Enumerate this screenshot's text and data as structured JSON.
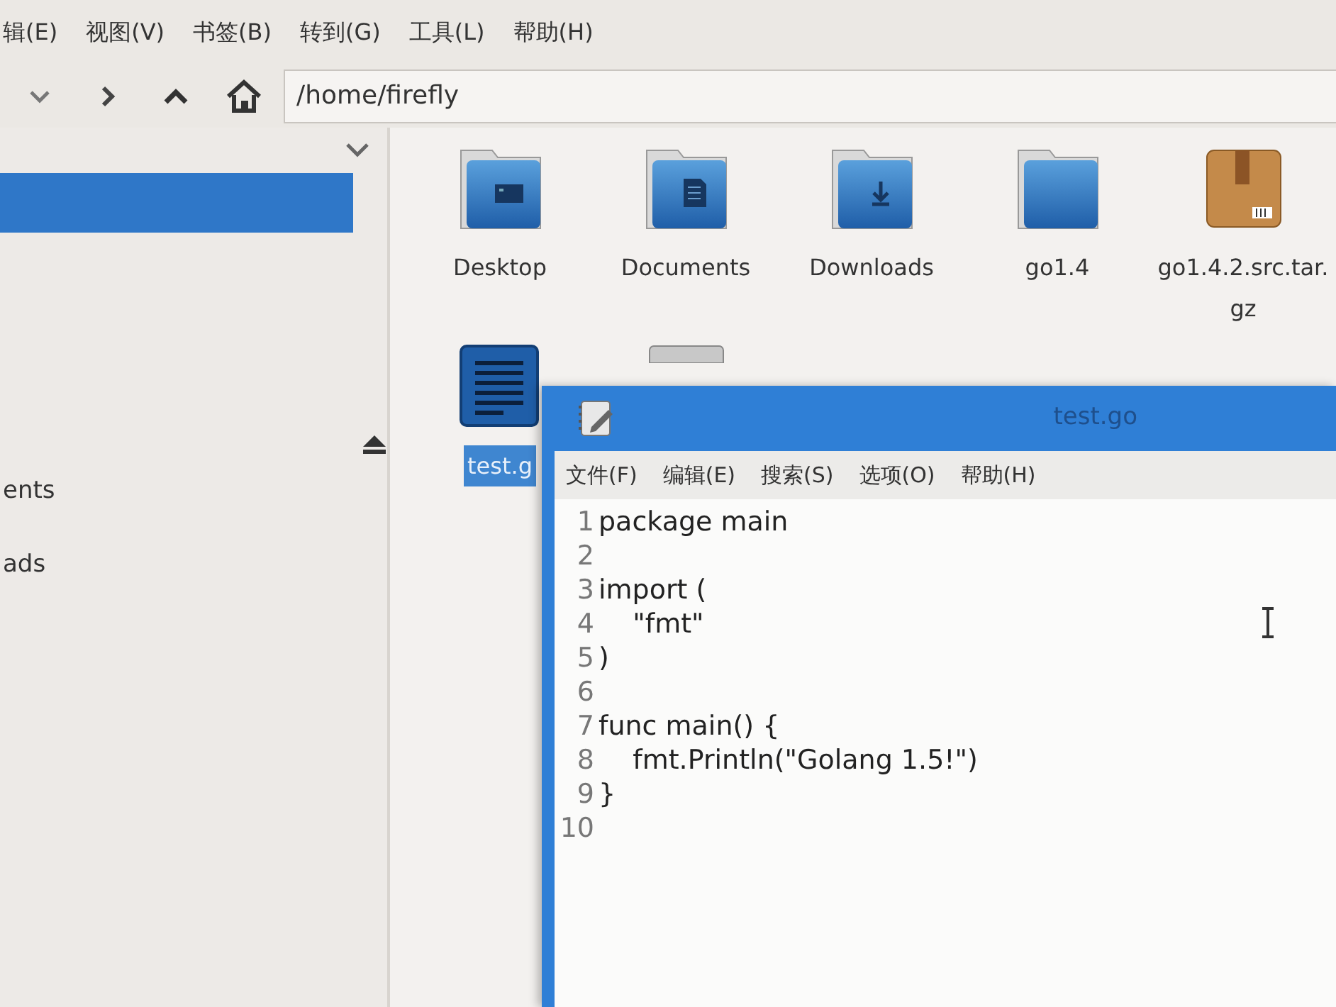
{
  "menu": [
    {
      "label": "辑(E)"
    },
    {
      "label": "视图(V)"
    },
    {
      "label": "书签(B)"
    },
    {
      "label": "转到(G)"
    },
    {
      "label": "工具(L)"
    },
    {
      "label": "帮助(H)"
    }
  ],
  "toolbar": {
    "path": "/home/firefly"
  },
  "sidebar": {
    "items": [
      {
        "selected": true
      },
      {
        "label": "ents",
        "selected": false
      },
      {
        "label": "ads",
        "selected": false
      }
    ]
  },
  "files": [
    {
      "name": "Desktop",
      "kind": "folder",
      "selected": false
    },
    {
      "name": "Documents",
      "kind": "folder",
      "selected": false
    },
    {
      "name": "Downloads",
      "kind": "folder",
      "selected": false
    },
    {
      "name": "go1.4",
      "kind": "folder",
      "selected": false
    },
    {
      "name": "go1.4.2.src.tar.gz",
      "kind": "archive",
      "selected": false
    },
    {
      "name": "test.g",
      "kind": "text",
      "selected": true
    },
    {
      "kind": "generic",
      "selected": false
    }
  ],
  "editor": {
    "title": "test.go",
    "menu": [
      {
        "label": "文件(F)"
      },
      {
        "label": "编辑(E)"
      },
      {
        "label": "搜索(S)"
      },
      {
        "label": "选项(O)"
      },
      {
        "label": "帮助(H)"
      }
    ],
    "lines": [
      {
        "number": "1",
        "text": "package main"
      },
      {
        "number": "2"
      },
      {
        "number": "3",
        "text": "import ("
      },
      {
        "number": "4",
        "text": "    \"fmt\""
      },
      {
        "number": "5",
        "text": ")"
      },
      {
        "number": "6"
      },
      {
        "number": "7",
        "text": "func main() {"
      },
      {
        "number": "8",
        "text": "    fmt.Println(\"Golang 1.5!\")"
      },
      {
        "number": "9",
        "text": "}"
      },
      {
        "number": "10"
      }
    ]
  }
}
